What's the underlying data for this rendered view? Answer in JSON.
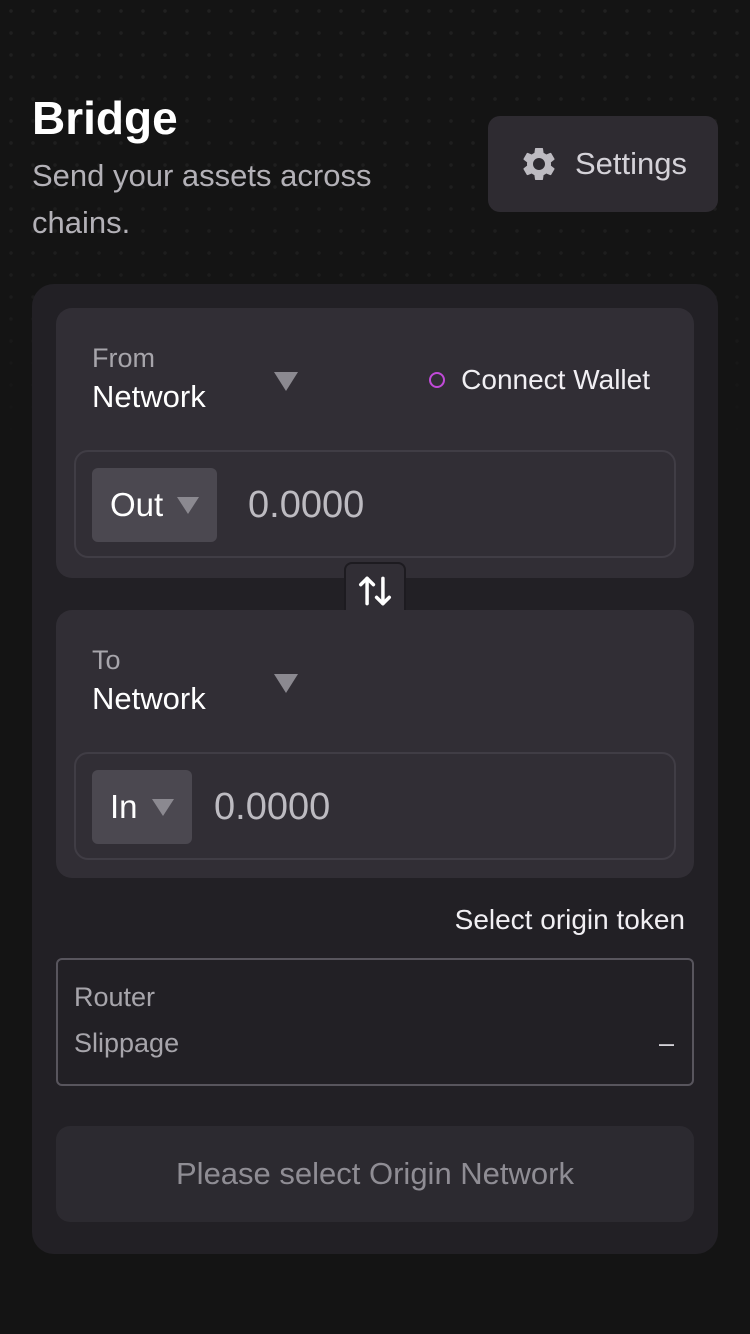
{
  "header": {
    "title": "Bridge",
    "subtitle": "Send your assets across chains.",
    "settings_label": "Settings",
    "settings_icon": "gear-icon"
  },
  "from_panel": {
    "label": "From",
    "network": "Network",
    "connect_wallet": "Connect Wallet",
    "token": "Out",
    "amount_placeholder": "0.0000"
  },
  "swap": {
    "icon": "swap-arrows-icon"
  },
  "to_panel": {
    "label": "To",
    "network": "Network",
    "token": "In",
    "amount_placeholder": "0.0000"
  },
  "origin_token_label": "Select origin token",
  "info": {
    "router_label": "Router",
    "slippage_label": "Slippage",
    "slippage_value": "–"
  },
  "submit_label": "Please select Origin Network",
  "colors": {
    "background": "#141414",
    "card": "#222025",
    "panel": "#312e35",
    "wallet_indicator": "#c04ad8"
  }
}
